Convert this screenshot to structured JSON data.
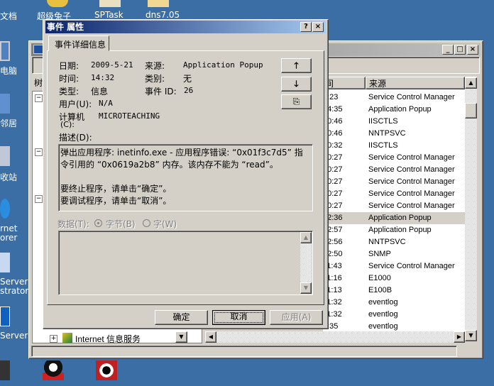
{
  "desktop": {
    "icons_top": [
      "超级兔子",
      "SPTask",
      "dns7.05"
    ],
    "icons_left": [
      "文档",
      "电脑",
      "邻居",
      "收站",
      "rnet\norer",
      "Server\nstrator",
      "Server"
    ]
  },
  "back_window": {
    "tree_tab": "树",
    "tree_item": "Internet 信息服务",
    "columns": [
      "间",
      "来源"
    ],
    "rows": [
      {
        "time": "2:23",
        "source": "Service Control Manager"
      },
      {
        "time": "04:35",
        "source": "Application Popup"
      },
      {
        "time": "50:46",
        "source": "IISCTLS"
      },
      {
        "time": "50:46",
        "source": "NNTPSVC"
      },
      {
        "time": "50:32",
        "source": "IISCTLS"
      },
      {
        "time": "50:27",
        "source": "Service Control Manager"
      },
      {
        "time": "50:27",
        "source": "Service Control Manager"
      },
      {
        "time": "50:27",
        "source": "Service Control Manager"
      },
      {
        "time": "50:27",
        "source": "Service Control Manager"
      },
      {
        "time": "50:27",
        "source": "Service Control Manager"
      },
      {
        "time": "32:36",
        "source": "Application Popup",
        "selected": true
      },
      {
        "time": "12:57",
        "source": "Application Popup"
      },
      {
        "time": "12:56",
        "source": "NNTPSVC"
      },
      {
        "time": "12:50",
        "source": "SNMP"
      },
      {
        "time": "11:43",
        "source": "Service Control Manager"
      },
      {
        "time": "11:16",
        "source": "E1000"
      },
      {
        "time": "11:13",
        "source": "E100B"
      },
      {
        "time": "11:32",
        "source": "eventlog"
      },
      {
        "time": "11:32",
        "source": "eventlog"
      },
      {
        "time": "8:35",
        "source": "eventlog"
      }
    ]
  },
  "dialog": {
    "title": "事件 属性",
    "tab": "事件详细信息",
    "date_label": "日期:",
    "date": "2009-5-21",
    "source_label": "来源:",
    "source": "Application Popup",
    "time_label": "时间:",
    "time": "14:32",
    "category_label": "类别:",
    "category": "无",
    "type_label": "类型:",
    "type": "信息",
    "eventid_label": "事件 ID:",
    "eventid": "26",
    "user_label": "用户(U):",
    "user": "N/A",
    "computer_label": "计算机",
    "computer_label2": "(C):",
    "computer": "MICROTEACHING",
    "desc_label": "描述(D):",
    "desc_lines": [
      "弹出应用程序: inetinfo.exe - 应用程序错误: “0x01f3c7d5” 指",
      "令引用的 “0x0619a2b8” 内存。该内存不能为 “read”。",
      "",
      "要终止程序，请单击“确定”。",
      "要调试程序，请单击“取消”。"
    ],
    "data_label": "数据(T):",
    "bytes_label": "字节(B)",
    "words_label": "字(W)",
    "ok": "确定",
    "cancel": "取消",
    "apply": "应用(A)"
  },
  "colors": {
    "desktop": "#3a6ea5",
    "title_active": "#0a246a",
    "face": "#d4d0c8",
    "selected_row": "#d4d0c8"
  }
}
